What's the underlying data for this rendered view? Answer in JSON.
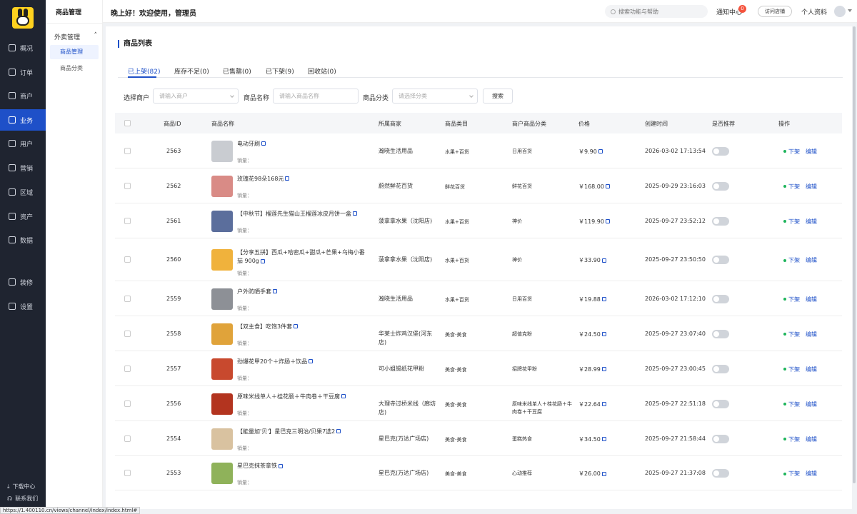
{
  "nav": {
    "items": [
      {
        "label": "概况",
        "icon": "dashboard-icon"
      },
      {
        "label": "订单",
        "icon": "order-icon"
      },
      {
        "label": "商户",
        "icon": "merchant-icon"
      },
      {
        "label": "业务",
        "icon": "business-icon",
        "active": true
      },
      {
        "label": "用户",
        "icon": "user-icon"
      },
      {
        "label": "营销",
        "icon": "marketing-icon"
      },
      {
        "label": "区域",
        "icon": "region-icon"
      },
      {
        "label": "资产",
        "icon": "asset-icon"
      },
      {
        "label": "数据",
        "icon": "chart-icon"
      },
      {
        "label": "装修",
        "icon": "decorate-icon"
      },
      {
        "label": "设置",
        "icon": "settings-icon"
      }
    ],
    "download": "下载中心",
    "contact": "联系我们"
  },
  "subnav": {
    "title": "商品管理",
    "group": "外卖管理",
    "items": [
      {
        "label": "商品管理",
        "active": true
      },
      {
        "label": "商品分类",
        "active": false
      }
    ]
  },
  "header": {
    "greeting": "晚上好！欢迎使用，管理员",
    "search_placeholder": "搜索功能与帮助",
    "notify": "通知中心",
    "notify_count": "0",
    "visit_store": "访问店铺",
    "profile": "个人资料"
  },
  "page": {
    "title": "商品列表",
    "tabs": [
      "已上架(82)",
      "库存不足(0)",
      "已售罄(0)",
      "已下架(9)",
      "回收站(0)"
    ]
  },
  "filters": {
    "merchant_label": "选择商户",
    "merchant_placeholder": "请输入商户",
    "name_label": "商品名称",
    "name_placeholder": "请输入商品名称",
    "category_label": "商品分类",
    "category_placeholder": "请选择分类",
    "search_button": "搜索"
  },
  "table": {
    "columns": [
      "商品ID",
      "商品名称",
      "所属商家",
      "商品类目",
      "商户商品分类",
      "价格",
      "创建时间",
      "是否推荐",
      "操作"
    ],
    "sales_label": "销量：",
    "action_off": "下架",
    "action_edit": "编辑",
    "rows": [
      {
        "id": "2563",
        "name": "电动牙刷",
        "merchant": "瀚晓生活用品",
        "category": "水果+百货",
        "shop_category": "日用百货",
        "price": "￥9.90",
        "created": "2026-03-02 17:13:54",
        "thumb": "#c9ccd1"
      },
      {
        "id": "2562",
        "name": "玫瑰花98朵168元",
        "merchant": "蔚然鲜花百货",
        "category": "鲜花百货",
        "shop_category": "鲜花百货",
        "price": "￥168.00",
        "created": "2025-09-29 23:16:03",
        "thumb": "#d98b86"
      },
      {
        "id": "2561",
        "name": "【中秋节】榴莲先生猫山王榴莲冰皮月饼一盒",
        "merchant": "菠拿拿水果（沈阳店)",
        "category": "水果+百货",
        "shop_category": "神价",
        "price": "￥119.90",
        "created": "2025-09-27 23:52:12",
        "thumb": "#5b6e9c"
      },
      {
        "id": "2560",
        "name": "【分享五拼】西瓜+哈密瓜+甜瓜+芒果+乌梅小番茄 900g",
        "merchant": "菠拿拿水果（沈阳店)",
        "category": "水果+百货",
        "shop_category": "神价",
        "price": "￥33.90",
        "created": "2025-09-27 23:50:50",
        "thumb": "#f0b23c"
      },
      {
        "id": "2559",
        "name": "户外防晒手套",
        "merchant": "瀚晓生活用品",
        "category": "水果+百货",
        "shop_category": "日用百货",
        "price": "￥19.88",
        "created": "2026-03-02 17:12:10",
        "thumb": "#8d9096"
      },
      {
        "id": "2558",
        "name": "【双主食】吃饱3件套",
        "merchant": "华莱士炸鸡汉堡(河东店)",
        "category": "美食-美食",
        "shop_category": "超值克粉",
        "price": "￥24.50",
        "created": "2025-09-27 23:07:40",
        "thumb": "#e0a33a"
      },
      {
        "id": "2557",
        "name": "劲爆花甲20个＋炸肠＋饮品",
        "merchant": "可小姐锡纸花甲粉",
        "category": "美食-美食",
        "shop_category": "招牌花甲粉",
        "price": "￥28.99",
        "created": "2025-09-27 23:00:45",
        "thumb": "#c8492e"
      },
      {
        "id": "2556",
        "name": "原味米线单人＋桂花肠＋牛肉卷＋干豆腐",
        "merchant": "大理寺过桥米线（廊坊店)",
        "category": "美食-美食",
        "shop_category": "原味米线单人＋桂花肠＋牛肉卷＋干豆腐",
        "price": "￥22.64",
        "created": "2025-09-27 22:51:18",
        "thumb": "#b3341f"
      },
      {
        "id": "2554",
        "name": "【能量加'贝'】星巴克三明治/贝果7选2",
        "merchant": "星巴克(万达广场店)",
        "category": "美食-美食",
        "shop_category": "蛋糕热食",
        "price": "￥34.50",
        "created": "2025-09-27 21:58:44",
        "thumb": "#d9c2a0"
      },
      {
        "id": "2553",
        "name": "星巴克抹茶拿铁",
        "merchant": "星巴克(万达广场店)",
        "category": "美食-美食",
        "shop_category": "心动推荐",
        "price": "￥26.00",
        "created": "2025-09-27 21:37:08",
        "thumb": "#8fb25a"
      }
    ]
  },
  "watermark": "https://www.huzhan.com/ishop27690",
  "status_url": "https://1.400110.cn/views/channel/index/index.html#"
}
